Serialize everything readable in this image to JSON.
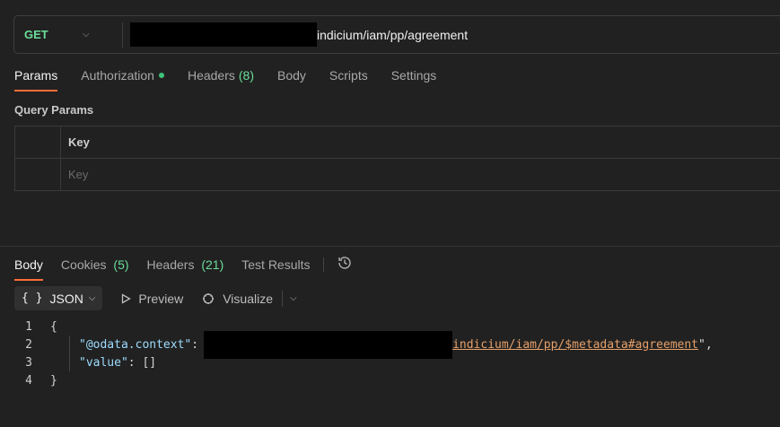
{
  "request": {
    "method": "GET",
    "url_visible": "indicium/iam/pp/agreement"
  },
  "request_tabs": [
    {
      "label": "Params",
      "active": true
    },
    {
      "label": "Authorization"
    },
    {
      "label": "Headers",
      "count": "(8)"
    },
    {
      "label": "Body"
    },
    {
      "label": "Scripts"
    },
    {
      "label": "Settings"
    }
  ],
  "query_params": {
    "title": "Query Params",
    "header": "Key",
    "placeholder": "Key"
  },
  "response_tabs": [
    {
      "label": "Body",
      "active": true
    },
    {
      "label": "Cookies",
      "count": "(5)"
    },
    {
      "label": "Headers",
      "count": "(21)"
    },
    {
      "label": "Test Results"
    }
  ],
  "format": {
    "braces": "{ }",
    "selected": "JSON",
    "preview": "Preview",
    "visualize": "Visualize"
  },
  "code": {
    "line_numbers": [
      "1",
      "2",
      "3",
      "4"
    ],
    "open": "{",
    "key1": "\"@odata.context\"",
    "colon": ": ",
    "link_visible": "indicium/iam/pp/$metadata#agreement",
    "tail": "\",",
    "key2": "\"value\"",
    "value2": ": []",
    "close": "}"
  },
  "colors": {
    "accent": "#ff6c37",
    "method_get": "#6bdd9a",
    "auth_dot": "#3fc37a"
  }
}
